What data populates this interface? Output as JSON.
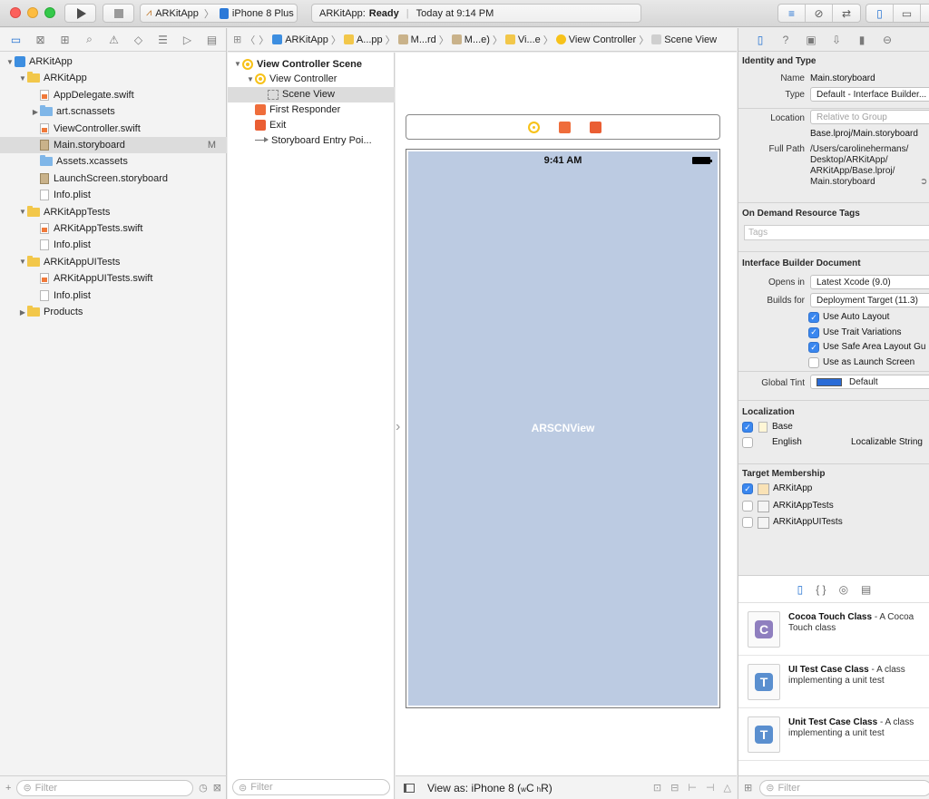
{
  "toolbar": {
    "scheme": "ARKitApp",
    "device": "iPhone 8 Plus",
    "status_app": "ARKitApp:",
    "status_state": "Ready",
    "status_time": "Today at 9:14 PM"
  },
  "navigator": {
    "tree": [
      {
        "label": "ARKitApp",
        "kind": "project",
        "depth": 0,
        "open": true
      },
      {
        "label": "ARKitApp",
        "kind": "folder",
        "depth": 1,
        "open": true
      },
      {
        "label": "AppDelegate.swift",
        "kind": "swift",
        "depth": 2
      },
      {
        "label": "art.scnassets",
        "kind": "folder-blue",
        "depth": 2,
        "open": false
      },
      {
        "label": "ViewController.swift",
        "kind": "swift",
        "depth": 2
      },
      {
        "label": "Main.storyboard",
        "kind": "storyboard",
        "depth": 2,
        "selected": true,
        "badge": "M"
      },
      {
        "label": "Assets.xcassets",
        "kind": "folder-blue",
        "depth": 2
      },
      {
        "label": "LaunchScreen.storyboard",
        "kind": "storyboard",
        "depth": 2
      },
      {
        "label": "Info.plist",
        "kind": "file",
        "depth": 2
      },
      {
        "label": "ARKitAppTests",
        "kind": "folder",
        "depth": 1,
        "open": true
      },
      {
        "label": "ARKitAppTests.swift",
        "kind": "swift",
        "depth": 2
      },
      {
        "label": "Info.plist",
        "kind": "file",
        "depth": 2
      },
      {
        "label": "ARKitAppUITests",
        "kind": "folder",
        "depth": 1,
        "open": true
      },
      {
        "label": "ARKitAppUITests.swift",
        "kind": "swift",
        "depth": 2
      },
      {
        "label": "Info.plist",
        "kind": "file",
        "depth": 2
      },
      {
        "label": "Products",
        "kind": "folder",
        "depth": 1,
        "open": false
      }
    ],
    "filter_placeholder": "Filter"
  },
  "jumpbar": [
    "ARKitApp",
    "A...pp",
    "M...rd",
    "M...e)",
    "Vi...e",
    "View Controller",
    "Scene View"
  ],
  "outline": {
    "rows": [
      {
        "label": "View Controller Scene",
        "icon": "scene",
        "depth": 0,
        "bold": true
      },
      {
        "label": "View Controller",
        "icon": "vc",
        "depth": 1
      },
      {
        "label": "Scene View",
        "icon": "sceneview",
        "depth": 2,
        "selected": true
      },
      {
        "label": "First Responder",
        "icon": "responder",
        "depth": 1
      },
      {
        "label": "Exit",
        "icon": "exit",
        "depth": 1
      },
      {
        "label": "Storyboard Entry Poi...",
        "icon": "arrow",
        "depth": 1
      }
    ],
    "filter_placeholder": "Filter"
  },
  "canvas": {
    "status_time": "9:41 AM",
    "view_label": "ARSCNView",
    "view_as": "View as: iPhone 8 (",
    "size_w": "w",
    "size_c": "C",
    "size_h": "h",
    "size_r": "R)"
  },
  "inspector": {
    "identity_title": "Identity and Type",
    "name_label": "Name",
    "name_value": "Main.storyboard",
    "type_label": "Type",
    "type_value": "Default - Interface Builder...",
    "location_label": "Location",
    "location_value": "Relative to Group",
    "location_path": "Base.lproj/Main.storyboard",
    "fullpath_label": "Full Path",
    "fullpath_lines": [
      "/Users/carolinehermans/",
      "Desktop/ARKitApp/",
      "ARKitApp/Base.lproj/",
      "Main.storyboard"
    ],
    "ondemand_title": "On Demand Resource Tags",
    "tags_placeholder": "Tags",
    "ibdoc_title": "Interface Builder Document",
    "opens_label": "Opens in",
    "opens_value": "Latest Xcode (9.0)",
    "builds_label": "Builds for",
    "builds_value": "Deployment Target (11.3)",
    "options": [
      {
        "label": "Use Auto Layout",
        "checked": true
      },
      {
        "label": "Use Trait Variations",
        "checked": true
      },
      {
        "label": "Use Safe Area Layout Gu",
        "checked": true
      },
      {
        "label": "Use as Launch Screen",
        "checked": false
      }
    ],
    "tint_label": "Global Tint",
    "tint_value": "Default",
    "tint_color": "#2a6cd7",
    "localization_title": "Localization",
    "localizations": [
      {
        "label": "Base",
        "checked": true
      },
      {
        "label": "English",
        "checked": false,
        "extra": "Localizable String"
      }
    ],
    "target_title": "Target Membership",
    "targets": [
      {
        "label": "ARKitApp",
        "checked": true
      },
      {
        "label": "ARKitAppTests",
        "checked": false
      },
      {
        "label": "ARKitAppUITests",
        "checked": false
      }
    ]
  },
  "library": {
    "items": [
      {
        "title": "Cocoa Touch Class",
        "desc_tail": " - A Cocoa",
        "desc2": "Touch class",
        "letter": "C",
        "color": "#8f7fbf"
      },
      {
        "title": "UI Test Case Class",
        "desc_tail": " - A class",
        "desc2": "implementing a unit test",
        "letter": "T",
        "color": "#5a8fcf"
      },
      {
        "title": "Unit Test Case Class",
        "desc_tail": " - A class",
        "desc2": "implementing a unit test",
        "letter": "T",
        "color": "#5a8fcf"
      }
    ],
    "filter_placeholder": "Filter"
  },
  "colors": {
    "accent": "#1f6fd1",
    "canvas_view": "#bccbe2",
    "close": "#fc605c",
    "minimize": "#fdbc40",
    "zoom": "#34c84a"
  }
}
